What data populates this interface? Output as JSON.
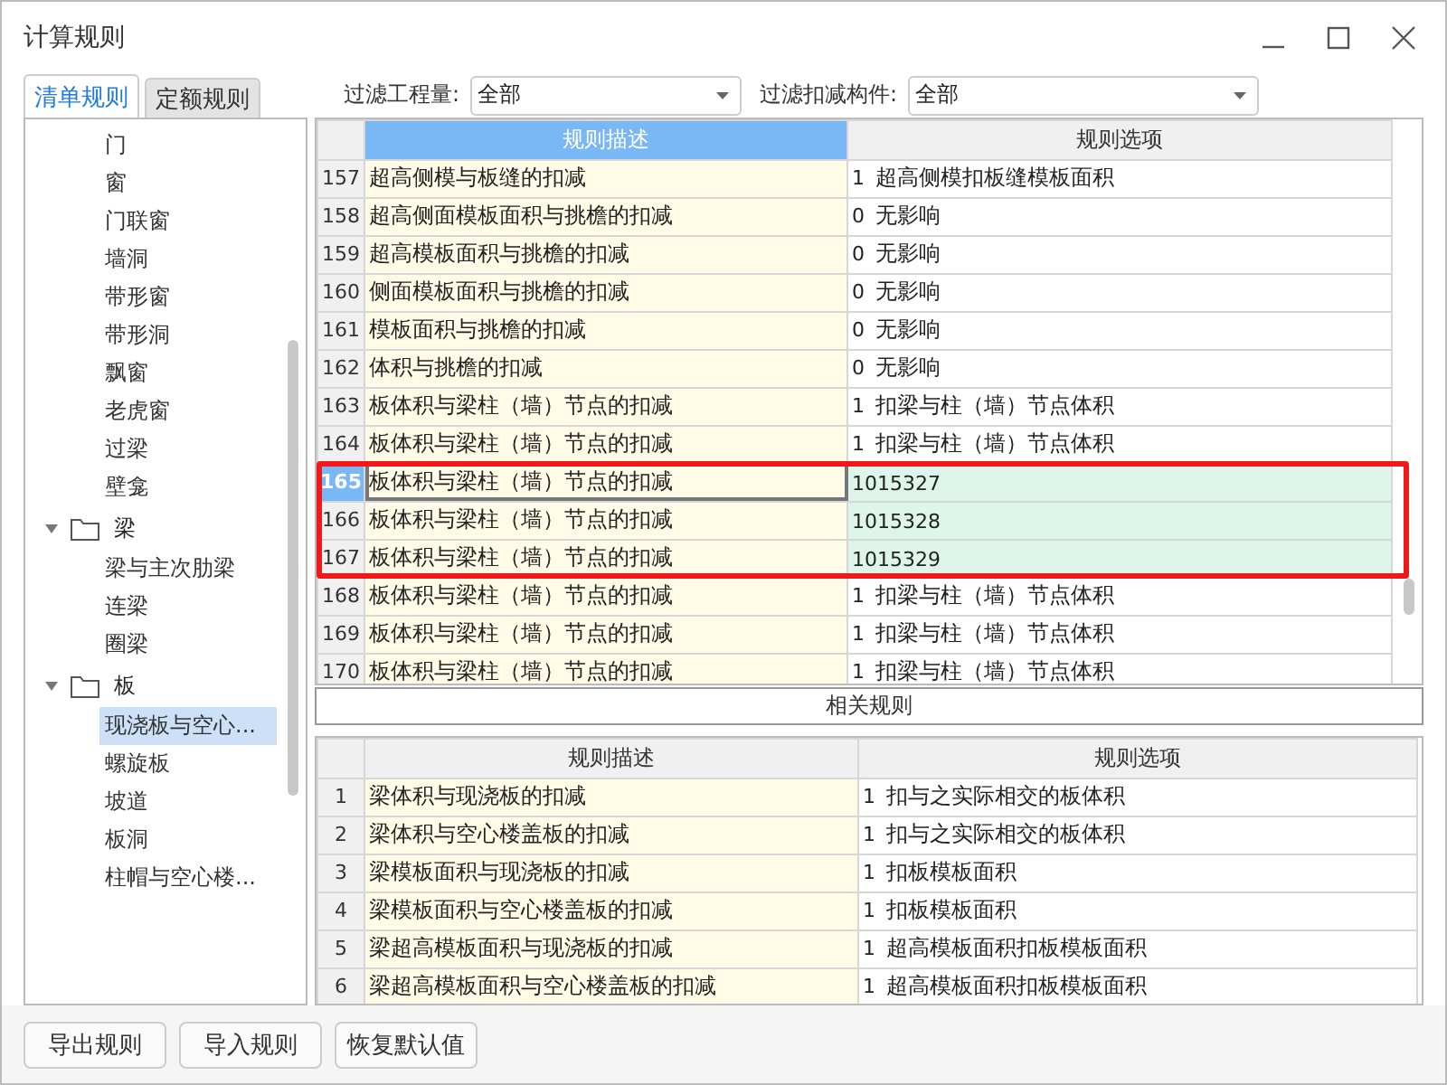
{
  "window": {
    "title": "计算规则"
  },
  "tabs": [
    {
      "label": "清单规则",
      "selected": true
    },
    {
      "label": "定额规则",
      "selected": false
    }
  ],
  "filters": [
    {
      "label": "过滤工程量:",
      "value": "全部"
    },
    {
      "label": "过滤扣减构件:",
      "value": "全部"
    }
  ],
  "tree": [
    {
      "label": "门",
      "selected": false
    },
    {
      "label": "窗",
      "selected": false
    },
    {
      "label": "门联窗",
      "selected": false
    },
    {
      "label": "墙洞",
      "selected": false
    },
    {
      "label": "带形窗",
      "selected": false
    },
    {
      "label": "带形洞",
      "selected": false
    },
    {
      "label": "飘窗",
      "selected": false
    },
    {
      "label": "老虎窗",
      "selected": false
    },
    {
      "label": "过梁",
      "selected": false
    },
    {
      "label": "壁龛",
      "selected": false
    },
    {
      "label": "梁",
      "selected": false,
      "expanded": true,
      "children": [
        {
          "label": "梁与主次肋梁",
          "selected": false
        },
        {
          "label": "连梁",
          "selected": false
        },
        {
          "label": "圈梁",
          "selected": false
        }
      ]
    },
    {
      "label": "板",
      "selected": false,
      "expanded": true,
      "children": [
        {
          "label": "现浇板与空心...",
          "selected": true
        },
        {
          "label": "螺旋板",
          "selected": false
        },
        {
          "label": "坡道",
          "selected": false
        },
        {
          "label": "板洞",
          "selected": false
        },
        {
          "label": "柱帽与空心楼...",
          "selected": false
        }
      ]
    }
  ],
  "main_table": {
    "columns": [
      {
        "label": "规则描述",
        "selected": true
      },
      {
        "label": "规则选项",
        "selected": false
      }
    ],
    "rows": [
      {
        "num": "157",
        "description": "超高侧模与板缝的扣减",
        "option_code": "1",
        "option": "超高侧模扣板缝模板面积",
        "selected": false,
        "highlighted": false
      },
      {
        "num": "158",
        "description": "超高侧面模板面积与挑檐的扣减",
        "option_code": "0",
        "option": "无影响",
        "selected": false,
        "highlighted": false
      },
      {
        "num": "159",
        "description": "超高模板面积与挑檐的扣减",
        "option_code": "0",
        "option": "无影响",
        "selected": false,
        "highlighted": false
      },
      {
        "num": "160",
        "description": "侧面模板面积与挑檐的扣减",
        "option_code": "0",
        "option": "无影响",
        "selected": false,
        "highlighted": false
      },
      {
        "num": "161",
        "description": "模板面积与挑檐的扣减",
        "option_code": "0",
        "option": "无影响",
        "selected": false,
        "highlighted": false
      },
      {
        "num": "162",
        "description": "体积与挑檐的扣减",
        "option_code": "0",
        "option": "无影响",
        "selected": false,
        "highlighted": false
      },
      {
        "num": "163",
        "description": "板体积与梁柱（墙）节点的扣减",
        "option_code": "1",
        "option": "扣梁与柱（墙）节点体积",
        "selected": false,
        "highlighted": false
      },
      {
        "num": "164",
        "description": "板体积与梁柱（墙）节点的扣减",
        "option_code": "1",
        "option": "扣梁与柱（墙）节点体积",
        "selected": false,
        "highlighted": false
      },
      {
        "num": "165",
        "description": "板体积与梁柱（墙）节点的扣减",
        "option_code": "1015327",
        "selected": true,
        "highlighted": true
      },
      {
        "num": "166",
        "description": "板体积与梁柱（墙）节点的扣减",
        "option_code": "1015328",
        "selected": false,
        "highlighted": true
      },
      {
        "num": "167",
        "description": "板体积与梁柱（墙）节点的扣减",
        "option_code": "1015329",
        "selected": false,
        "highlighted": true
      },
      {
        "num": "168",
        "description": "板体积与梁柱（墙）节点的扣减",
        "option_code": "1",
        "option": "扣梁与柱（墙）节点体积",
        "selected": false,
        "highlighted": false
      },
      {
        "num": "169",
        "description": "板体积与梁柱（墙）节点的扣减",
        "option_code": "1",
        "option": "扣梁与柱（墙）节点体积",
        "selected": false,
        "highlighted": false
      },
      {
        "num": "170",
        "description": "板体积与梁柱（墙）节点的扣减",
        "option_code": "1",
        "option": "扣梁与柱（墙）节点体积",
        "selected": false,
        "highlighted": false
      }
    ]
  },
  "related_button": "相关规则",
  "related_table": {
    "columns": [
      {
        "label": "规则描述",
        "selected": false
      },
      {
        "label": "规则选项",
        "selected": false
      }
    ],
    "rows": [
      {
        "num": "1",
        "description": "梁体积与现浇板的扣减",
        "option_code": "1",
        "option": "扣与之实际相交的板体积"
      },
      {
        "num": "2",
        "description": "梁体积与空心楼盖板的扣减",
        "option_code": "1",
        "option": "扣与之实际相交的板体积"
      },
      {
        "num": "3",
        "description": "梁模板面积与现浇板的扣减",
        "option_code": "1",
        "option": "扣板模板面积"
      },
      {
        "num": "4",
        "description": "梁模板面积与空心楼盖板的扣减",
        "option_code": "1",
        "option": "扣板模板面积"
      },
      {
        "num": "5",
        "description": "梁超高模板面积与现浇板的扣减",
        "option_code": "1",
        "option": "超高模板面积扣板模板面积"
      },
      {
        "num": "6",
        "description": "梁超高模板面积与空心楼盖板的扣减",
        "option_code": "1",
        "option": "超高模板面积扣板模板面积"
      }
    ]
  },
  "buttons": [
    "导出规则",
    "导入规则",
    "恢复默认值"
  ]
}
